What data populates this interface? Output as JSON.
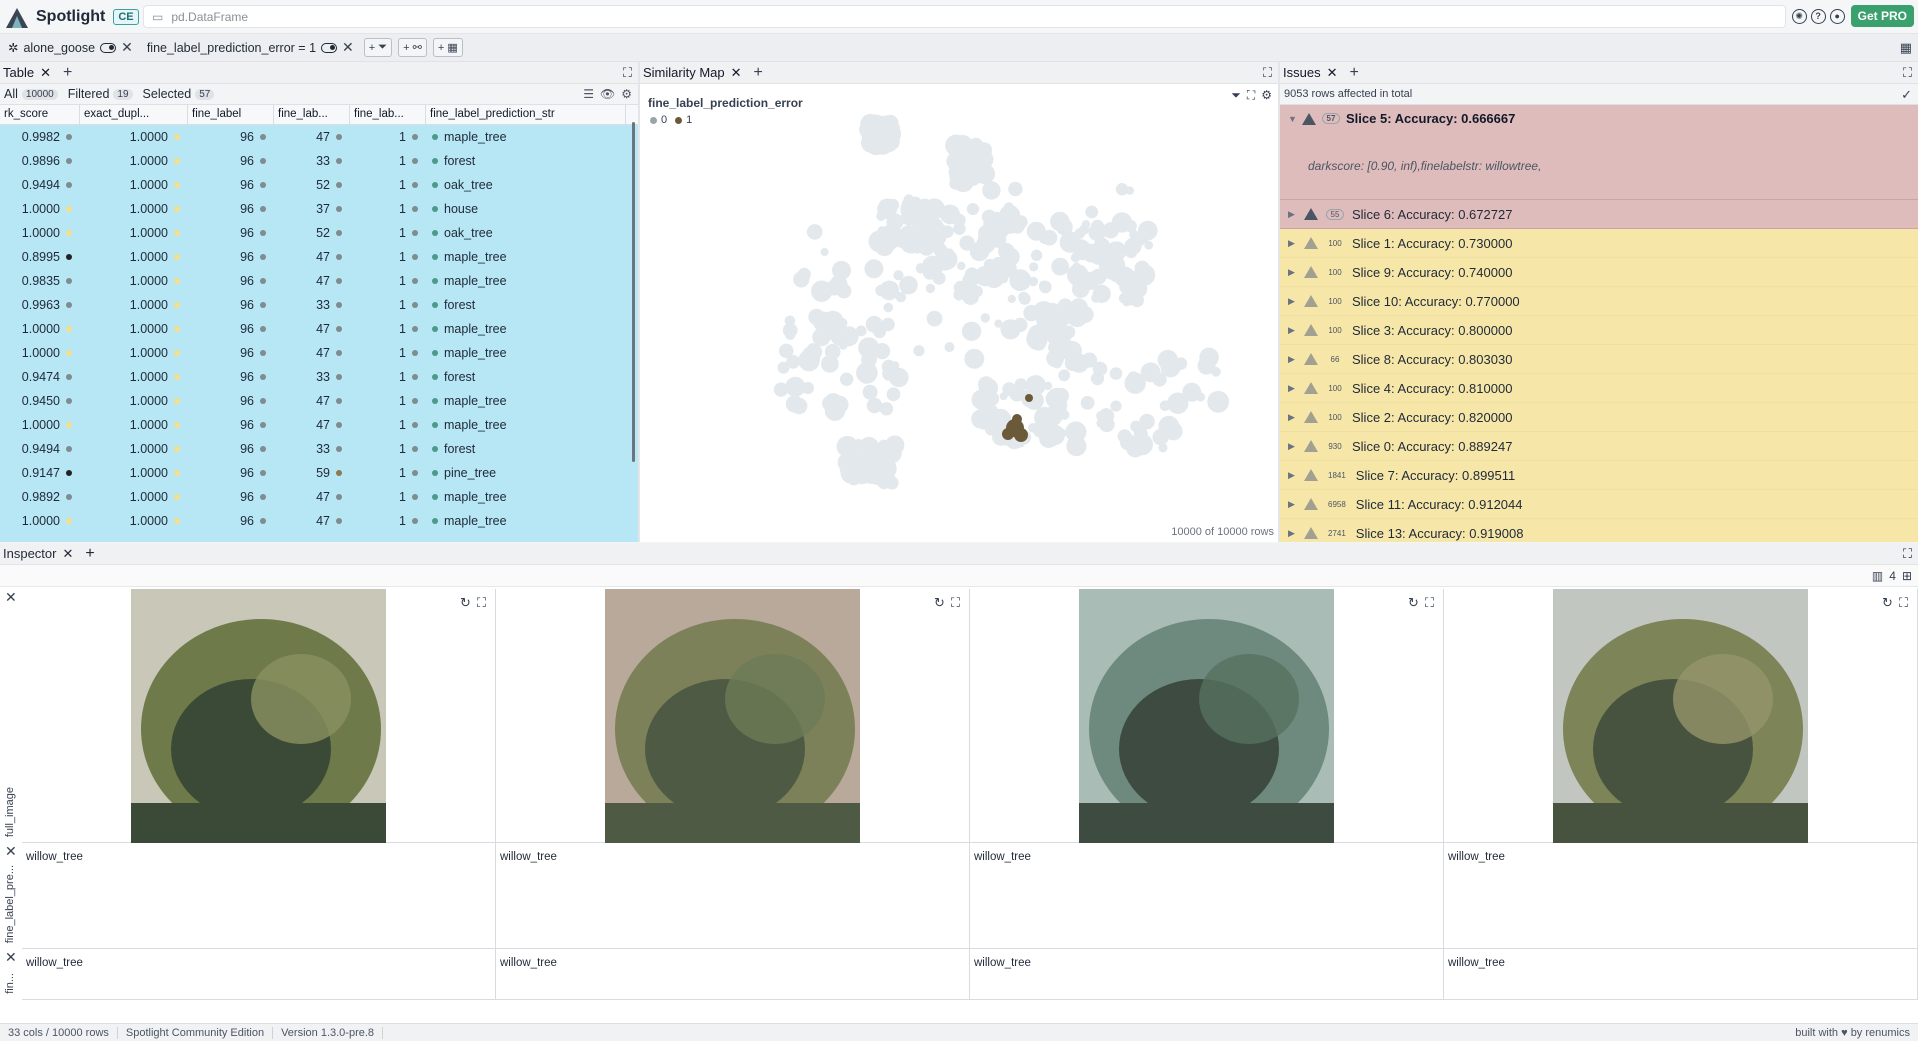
{
  "app": {
    "name": "Spotlight",
    "edition_badge": "CE",
    "path": "pd.DataFrame",
    "get_pro": "Get PRO"
  },
  "top_icons": [
    "brain-icon",
    "help-icon",
    "github-icon"
  ],
  "filterbar": {
    "dataset": "alone_goose",
    "filter_expr": "fine_label_prediction_error = 1",
    "btn_add_filter": "+",
    "btn_add_similarity": "+",
    "btn_add_tag": "+"
  },
  "table": {
    "tab_title": "Table",
    "all_label": "All",
    "all_count": "10000",
    "filtered_label": "Filtered",
    "filtered_count": "19",
    "selected_label": "Selected",
    "selected_count": "57",
    "columns": [
      "rk_score",
      "exact_dupl...",
      "fine_label",
      "fine_lab...",
      "fine_lab...",
      "fine_label_prediction_str"
    ],
    "rows": [
      [
        "0.9982",
        "1.0000",
        "96",
        "47",
        "1",
        "maple_tree"
      ],
      [
        "0.9896",
        "1.0000",
        "96",
        "33",
        "1",
        "forest"
      ],
      [
        "0.9494",
        "1.0000",
        "96",
        "52",
        "1",
        "oak_tree"
      ],
      [
        "1.0000",
        "1.0000",
        "96",
        "37",
        "1",
        "house"
      ],
      [
        "1.0000",
        "1.0000",
        "96",
        "52",
        "1",
        "oak_tree"
      ],
      [
        "0.8995",
        "1.0000",
        "96",
        "47",
        "1",
        "maple_tree"
      ],
      [
        "0.9835",
        "1.0000",
        "96",
        "47",
        "1",
        "maple_tree"
      ],
      [
        "0.9963",
        "1.0000",
        "96",
        "33",
        "1",
        "forest"
      ],
      [
        "1.0000",
        "1.0000",
        "96",
        "47",
        "1",
        "maple_tree"
      ],
      [
        "1.0000",
        "1.0000",
        "96",
        "47",
        "1",
        "maple_tree"
      ],
      [
        "0.9474",
        "1.0000",
        "96",
        "33",
        "1",
        "forest"
      ],
      [
        "0.9450",
        "1.0000",
        "96",
        "47",
        "1",
        "maple_tree"
      ],
      [
        "1.0000",
        "1.0000",
        "96",
        "47",
        "1",
        "maple_tree"
      ],
      [
        "0.9494",
        "1.0000",
        "96",
        "33",
        "1",
        "forest"
      ],
      [
        "0.9147",
        "1.0000",
        "96",
        "59",
        "1",
        "pine_tree"
      ],
      [
        "0.9892",
        "1.0000",
        "96",
        "47",
        "1",
        "maple_tree"
      ],
      [
        "1.0000",
        "1.0000",
        "96",
        "47",
        "1",
        "maple_tree"
      ]
    ]
  },
  "map": {
    "tab_title": "Similarity Map",
    "color_by": "fine_label_prediction_error",
    "legend": [
      "0",
      "1"
    ],
    "footer": "10000 of 10000 rows"
  },
  "issues": {
    "tab_title": "Issues",
    "summary": "9053 rows affected in total",
    "open_issue": {
      "count": "57",
      "title": "Slice 5: Accuracy: 0.666667",
      "desc": "darkscore: [0.90, inf),finelabelstr: willowtree,"
    },
    "items": [
      {
        "count": "55",
        "title": "Slice 6: Accuracy: 0.672727",
        "severity": "high"
      },
      {
        "count": "100",
        "title": "Slice 1: Accuracy: 0.730000",
        "severity": "medium"
      },
      {
        "count": "100",
        "title": "Slice 9: Accuracy: 0.740000",
        "severity": "medium"
      },
      {
        "count": "100",
        "title": "Slice 10: Accuracy: 0.770000",
        "severity": "medium"
      },
      {
        "count": "100",
        "title": "Slice 3: Accuracy: 0.800000",
        "severity": "medium"
      },
      {
        "count": "66",
        "title": "Slice 8: Accuracy: 0.803030",
        "severity": "medium"
      },
      {
        "count": "100",
        "title": "Slice 4: Accuracy: 0.810000",
        "severity": "medium"
      },
      {
        "count": "100",
        "title": "Slice 2: Accuracy: 0.820000",
        "severity": "medium"
      },
      {
        "count": "930",
        "title": "Slice 0: Accuracy: 0.889247",
        "severity": "medium"
      },
      {
        "count": "1841",
        "title": "Slice 7: Accuracy: 0.899511",
        "severity": "medium"
      },
      {
        "count": "6958",
        "title": "Slice 11: Accuracy: 0.912044",
        "severity": "medium"
      },
      {
        "count": "2741",
        "title": "Slice 13: Accuracy: 0.919008",
        "severity": "medium"
      }
    ]
  },
  "inspector": {
    "tab_title": "Inspector",
    "columns_count": "4",
    "row_labels": [
      "full_image",
      "fine_label_pre...",
      "fin..."
    ],
    "cells": [
      {
        "label1": "willow_tree",
        "label2": "willow_tree"
      },
      {
        "label1": "willow_tree",
        "label2": "willow_tree"
      },
      {
        "label1": "willow_tree",
        "label2": "willow_tree"
      },
      {
        "label1": "willow_tree",
        "label2": "willow_tree"
      }
    ]
  },
  "status": {
    "dims": "33 cols / 10000 rows",
    "edition": "Spotlight Community Edition",
    "version": "Version 1.3.0-pre.8",
    "built": "built with ♥ by renumics"
  },
  "colors": {
    "table_bg": "#b7e6f5",
    "issue_high": "#dfbcbc",
    "issue_medium": "#f6e7a9",
    "accent": "#3aa06e"
  }
}
